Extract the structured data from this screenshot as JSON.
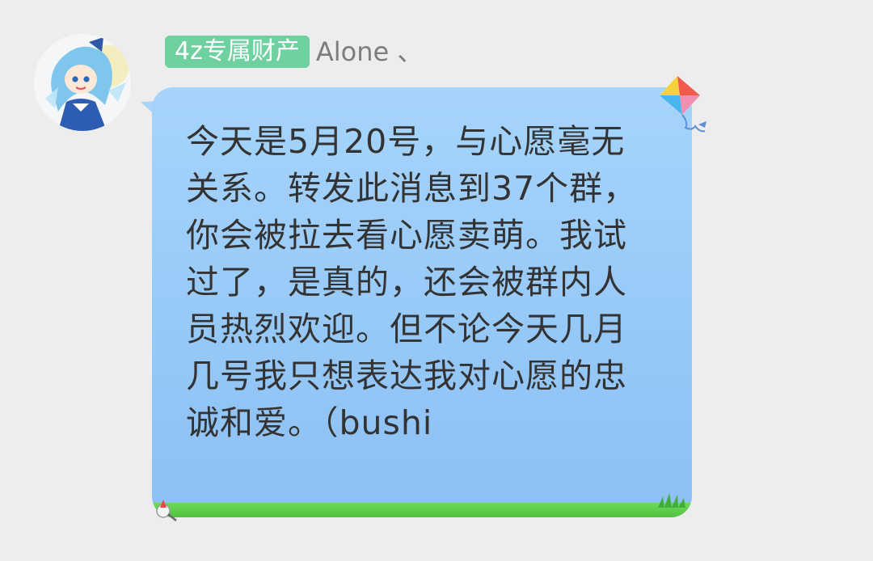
{
  "message": {
    "sender": {
      "title_badge": "4z专属财产",
      "name": "Alone 、"
    },
    "avatar_icon": "anime-character-avatar",
    "bubble_theme": {
      "icons": [
        "kite-icon",
        "grass-icon",
        "pin-icon"
      ],
      "bubble_color": "#9ccdf8",
      "grass_color": "#5acb45",
      "badge_color": "#6fd0a0"
    },
    "text": "今天是5月20号，与心愿毫无关系。转发此消息到37个群，你会被拉去看心愿卖萌。我试过了，是真的，还会被群内人员热烈欢迎。但不论今天几月几号我只想表达我对心愿的忠诚和爱。（bushi"
  }
}
